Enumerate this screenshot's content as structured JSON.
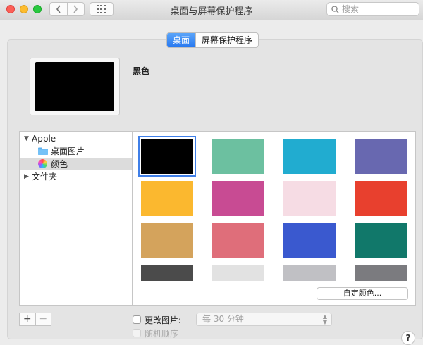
{
  "window": {
    "title": "桌面与屏幕保护程序",
    "search_placeholder": "搜索",
    "nav_back_glyph": "‹",
    "nav_forward_glyph": "›"
  },
  "tabs": [
    {
      "label": "桌面",
      "active": true
    },
    {
      "label": "屏幕保护程序",
      "active": false
    }
  ],
  "preview": {
    "current_name": "黑色",
    "color": "#000000"
  },
  "sidebar": {
    "groups": [
      {
        "label": "Apple",
        "expanded": true,
        "children": [
          {
            "label": "桌面图片",
            "icon": "folder-icon",
            "selected": false
          },
          {
            "label": "颜色",
            "icon": "color-wheel-icon",
            "selected": true
          }
        ]
      },
      {
        "label": "文件夹",
        "expanded": false,
        "children": []
      }
    ]
  },
  "swatches": [
    {
      "color": "#000000",
      "selected": true
    },
    {
      "color": "#6cc0a0"
    },
    {
      "color": "#21acd0"
    },
    {
      "color": "#6868b0"
    },
    {
      "color": "#fbb82f"
    },
    {
      "color": "#c84b93"
    },
    {
      "color": "#f6dce4"
    },
    {
      "color": "#e8402e"
    },
    {
      "color": "#d4a35c"
    },
    {
      "color": "#df6e7a"
    },
    {
      "color": "#3a59cf"
    },
    {
      "color": "#11786a"
    },
    {
      "color": "#4b4b4b"
    },
    {
      "color": "#e2e2e2"
    },
    {
      "color": "#c0c0c4"
    },
    {
      "color": "#7b7b7f"
    }
  ],
  "custom_color_button": "自定颜色...",
  "bottom": {
    "add_label": "+",
    "remove_label": "−",
    "change_picture_label": "更改图片:",
    "interval_value": "每 30 分钟",
    "random_order_label": "随机顺序",
    "help_label": "?"
  },
  "colors": {
    "accent": "#2879f0",
    "selection": "#3f7fe8"
  }
}
